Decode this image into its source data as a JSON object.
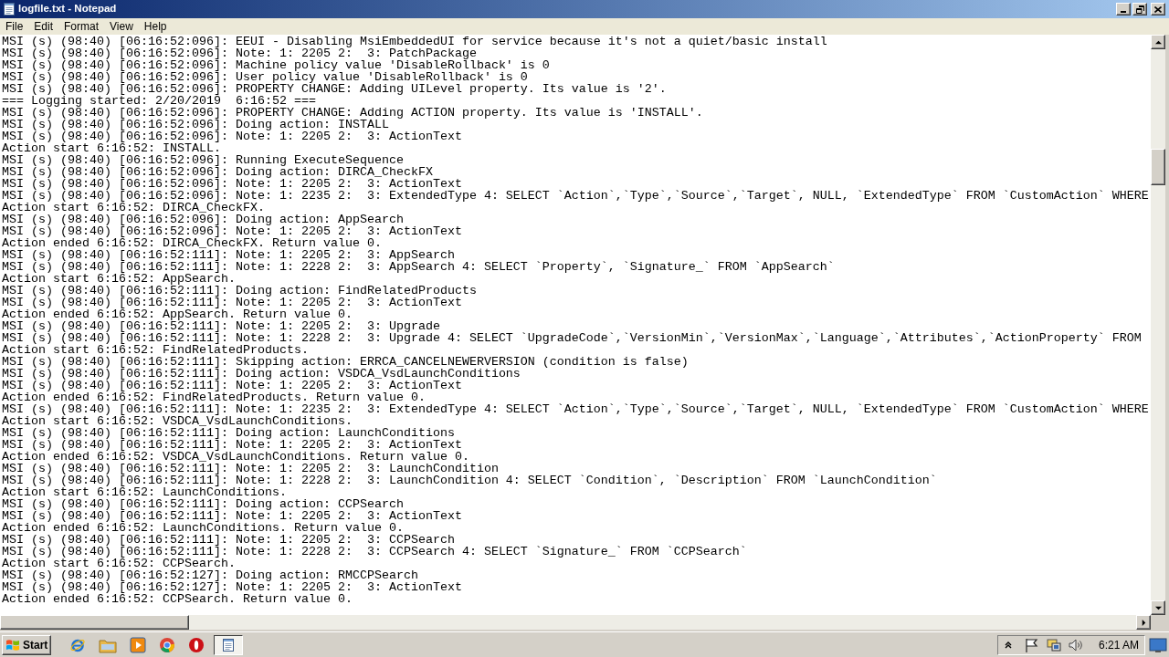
{
  "window": {
    "title": "logfile.txt - Notepad"
  },
  "menu": [
    "File",
    "Edit",
    "Format",
    "View",
    "Help"
  ],
  "editor": {
    "lines": [
      "MSI (s) (98:40) [06:16:52:096]: EEUI - Disabling MsiEmbeddedUI for service because it's not a quiet/basic install",
      "MSI (s) (98:40) [06:16:52:096]: Note: 1: 2205 2:  3: PatchPackage",
      "MSI (s) (98:40) [06:16:52:096]: Machine policy value 'DisableRollback' is 0",
      "MSI (s) (98:40) [06:16:52:096]: User policy value 'DisableRollback' is 0",
      "MSI (s) (98:40) [06:16:52:096]: PROPERTY CHANGE: Adding UILevel property. Its value is '2'.",
      "=== Logging started: 2/20/2019  6:16:52 ===",
      "MSI (s) (98:40) [06:16:52:096]: PROPERTY CHANGE: Adding ACTION property. Its value is 'INSTALL'.",
      "MSI (s) (98:40) [06:16:52:096]: Doing action: INSTALL",
      "MSI (s) (98:40) [06:16:52:096]: Note: 1: 2205 2:  3: ActionText",
      "Action start 6:16:52: INSTALL.",
      "MSI (s) (98:40) [06:16:52:096]: Running ExecuteSequence",
      "MSI (s) (98:40) [06:16:52:096]: Doing action: DIRCA_CheckFX",
      "MSI (s) (98:40) [06:16:52:096]: Note: 1: 2205 2:  3: ActionText",
      "MSI (s) (98:40) [06:16:52:096]: Note: 1: 2235 2:  3: ExtendedType 4: SELECT `Action`,`Type`,`Source`,`Target`, NULL, `ExtendedType` FROM `CustomAction` WHERE",
      "Action start 6:16:52: DIRCA_CheckFX.",
      "MSI (s) (98:40) [06:16:52:096]: Doing action: AppSearch",
      "MSI (s) (98:40) [06:16:52:096]: Note: 1: 2205 2:  3: ActionText",
      "Action ended 6:16:52: DIRCA_CheckFX. Return value 0.",
      "MSI (s) (98:40) [06:16:52:111]: Note: 1: 2205 2:  3: AppSearch",
      "MSI (s) (98:40) [06:16:52:111]: Note: 1: 2228 2:  3: AppSearch 4: SELECT `Property`, `Signature_` FROM `AppSearch`",
      "Action start 6:16:52: AppSearch.",
      "MSI (s) (98:40) [06:16:52:111]: Doing action: FindRelatedProducts",
      "MSI (s) (98:40) [06:16:52:111]: Note: 1: 2205 2:  3: ActionText",
      "Action ended 6:16:52: AppSearch. Return value 0.",
      "MSI (s) (98:40) [06:16:52:111]: Note: 1: 2205 2:  3: Upgrade",
      "MSI (s) (98:40) [06:16:52:111]: Note: 1: 2228 2:  3: Upgrade 4: SELECT `UpgradeCode`,`VersionMin`,`VersionMax`,`Language`,`Attributes`,`ActionProperty` FROM",
      "Action start 6:16:52: FindRelatedProducts.",
      "MSI (s) (98:40) [06:16:52:111]: Skipping action: ERRCA_CANCELNEWERVERSION (condition is false)",
      "MSI (s) (98:40) [06:16:52:111]: Doing action: VSDCA_VsdLaunchConditions",
      "MSI (s) (98:40) [06:16:52:111]: Note: 1: 2205 2:  3: ActionText",
      "Action ended 6:16:52: FindRelatedProducts. Return value 0.",
      "MSI (s) (98:40) [06:16:52:111]: Note: 1: 2235 2:  3: ExtendedType 4: SELECT `Action`,`Type`,`Source`,`Target`, NULL, `ExtendedType` FROM `CustomAction` WHERE",
      "Action start 6:16:52: VSDCA_VsdLaunchConditions.",
      "MSI (s) (98:40) [06:16:52:111]: Doing action: LaunchConditions",
      "MSI (s) (98:40) [06:16:52:111]: Note: 1: 2205 2:  3: ActionText",
      "Action ended 6:16:52: VSDCA_VsdLaunchConditions. Return value 0.",
      "MSI (s) (98:40) [06:16:52:111]: Note: 1: 2205 2:  3: LaunchCondition",
      "MSI (s) (98:40) [06:16:52:111]: Note: 1: 2228 2:  3: LaunchCondition 4: SELECT `Condition`, `Description` FROM `LaunchCondition`",
      "Action start 6:16:52: LaunchConditions.",
      "MSI (s) (98:40) [06:16:52:111]: Doing action: CCPSearch",
      "MSI (s) (98:40) [06:16:52:111]: Note: 1: 2205 2:  3: ActionText",
      "Action ended 6:16:52: LaunchConditions. Return value 0.",
      "MSI (s) (98:40) [06:16:52:111]: Note: 1: 2205 2:  3: CCPSearch",
      "MSI (s) (98:40) [06:16:52:111]: Note: 1: 2228 2:  3: CCPSearch 4: SELECT `Signature_` FROM `CCPSearch`",
      "Action start 6:16:52: CCPSearch.",
      "MSI (s) (98:40) [06:16:52:127]: Doing action: RMCCPSearch",
      "MSI (s) (98:40) [06:16:52:127]: Note: 1: 2205 2:  3: ActionText",
      "Action ended 6:16:52: CCPSearch. Return value 0."
    ]
  },
  "taskbar": {
    "start": "Start",
    "tasks": [
      {
        "kind": "notepad",
        "selected": true
      }
    ],
    "clock": "6:21 AM"
  }
}
